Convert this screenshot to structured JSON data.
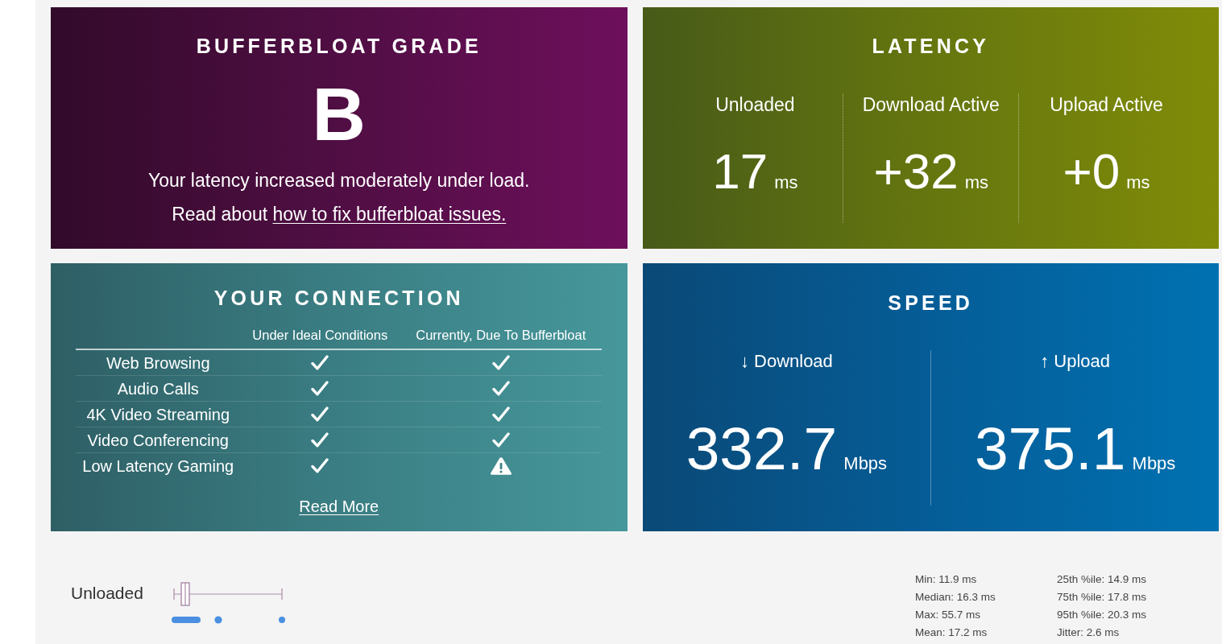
{
  "grade_panel": {
    "title": "BUFFERBLOAT GRADE",
    "grade": "B",
    "summary": "Your latency increased moderately under load.",
    "guide_text": "Read about",
    "guide_link": "how to fix bufferbloat issues."
  },
  "latency_panel": {
    "title": "LATENCY",
    "columns": [
      {
        "label": "Unloaded",
        "value": "17",
        "unit": "ms"
      },
      {
        "label": "Download Active",
        "value": "+32",
        "unit": "ms"
      },
      {
        "label": "Upload Active",
        "value": "+0",
        "unit": "ms"
      }
    ]
  },
  "connection_panel": {
    "title": "YOUR CONNECTION",
    "columns": [
      "Under Ideal Conditions",
      "Currently, Due To Bufferbloat"
    ],
    "rows": [
      {
        "activity": "Web Browsing",
        "ideal_ok": true,
        "current_ok": true
      },
      {
        "activity": "Audio Calls",
        "ideal_ok": true,
        "current_ok": true
      },
      {
        "activity": "4K Video Streaming",
        "ideal_ok": true,
        "current_ok": true
      },
      {
        "activity": "Video Conferencing",
        "ideal_ok": true,
        "current_ok": true
      },
      {
        "activity": "Low Latency Gaming",
        "ideal_ok": true,
        "current_ok": false
      }
    ],
    "read_more": "Read More"
  },
  "speed_panel": {
    "title": "SPEED",
    "columns": [
      {
        "label": "↓ Download",
        "value": "332.7",
        "unit": "Mbps"
      },
      {
        "label": "↑ Upload",
        "value": "375.1",
        "unit": "Mbps"
      }
    ]
  },
  "latency_detail": {
    "label": "Unloaded",
    "stat_columns": [
      [
        "Min: 11.9 ms",
        "Median: 16.3 ms",
        "Max: 55.7 ms",
        "Mean: 17.2 ms"
      ],
      [
        "25th %ile: 14.9 ms",
        "75th %ile: 17.8 ms",
        "95th %ile: 20.3 ms",
        "Jitter: 2.6 ms"
      ]
    ]
  }
}
